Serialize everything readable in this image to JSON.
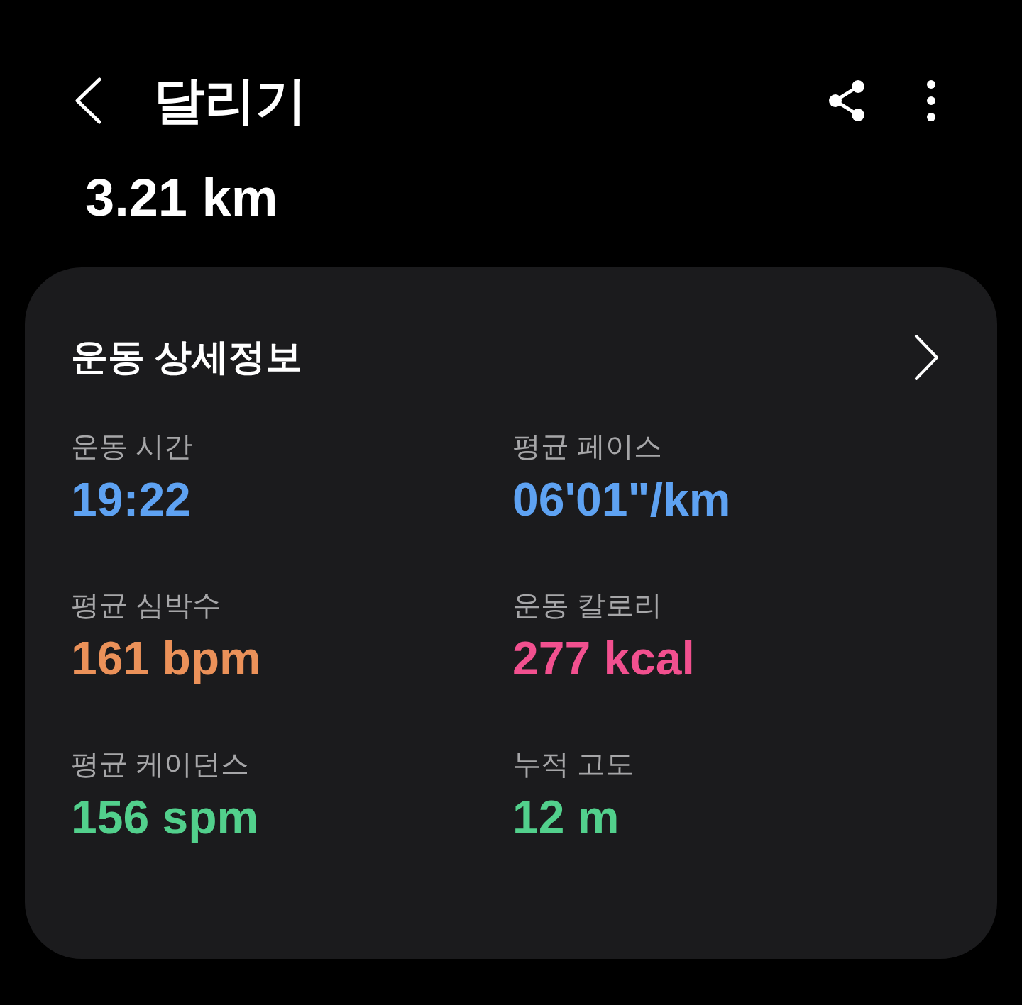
{
  "header": {
    "title": "달리기"
  },
  "distance": "3.21 km",
  "card": {
    "title": "운동 상세정보",
    "stats": [
      {
        "label": "운동 시간",
        "value": "19:22",
        "color": "#5ea2f2"
      },
      {
        "label": "평균 페이스",
        "value": "06'01\"/km",
        "color": "#5ea2f2"
      },
      {
        "label": "평균 심박수",
        "value": "161 bpm",
        "color": "#eb9159"
      },
      {
        "label": "운동 칼로리",
        "value": "277 kcal",
        "color": "#f2508f"
      },
      {
        "label": "평균 케이던스",
        "value": "156 spm",
        "color": "#52d08c"
      },
      {
        "label": "누적 고도",
        "value": "12 m",
        "color": "#52d08c"
      }
    ]
  }
}
